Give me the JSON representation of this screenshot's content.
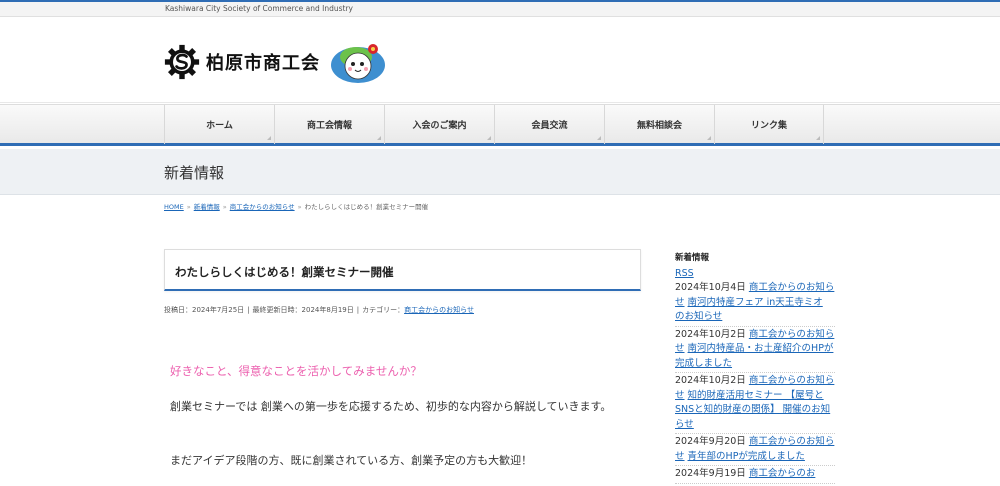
{
  "topbar": {
    "text": "Kashiwara City Society of Commerce and Industry"
  },
  "header": {
    "logo_text": "柏原市商工会"
  },
  "nav": {
    "items": [
      "ホーム",
      "商工会情報",
      "入会のご案内",
      "会員交流",
      "無料相談会",
      "リンク集"
    ]
  },
  "page_title": "新着情報",
  "breadcrumb": {
    "home": "HOME",
    "news": "新着情報",
    "category": "商工会からのお知らせ",
    "current": "わたしらしくはじめる！創業セミナー開催",
    "separator": "»"
  },
  "article": {
    "title": "わたしらしくはじめる！創業セミナー開催",
    "meta": {
      "posted": "投稿日：2024年7月25日",
      "updated": "最終更新日時：2024年8月19日",
      "category_label": "カテゴリー：",
      "category": "商工会からのお知らせ",
      "divider": "|"
    },
    "lead": "好きなこと、得意なことを活かしてみませんか？",
    "paragraph1": "創業セミナーでは 創業への第一歩を応援するため、初歩的な内容から解説していきます。",
    "paragraph2": "まだアイデア段階の方、既に創業されている方、創業予定の方も大歓迎！"
  },
  "sidebar": {
    "heading": "新着情報",
    "rss": "RSS",
    "items": [
      {
        "date": "2024年10月4日",
        "category": "商工会からのお知らせ",
        "title": "南河内特産フェア in天王寺ミオ のお知らせ"
      },
      {
        "date": "2024年10月2日",
        "category": "商工会からのお知らせ",
        "title": "南河内特産品・お土産紹介のHPが完成しました"
      },
      {
        "date": "2024年10月2日",
        "category": "商工会からのお知らせ",
        "title": "知的財産活用セミナー 【屋号とSNSと知的財産の関係】 開催のお知らせ"
      },
      {
        "date": "2024年9月20日",
        "category": "商工会からのお知らせ",
        "title": "青年部のHPが完成しました"
      },
      {
        "date": "2024年9月19日",
        "category": "商工会からのお",
        "title": ""
      }
    ]
  },
  "colors": {
    "accent": "#2f6db5",
    "link": "#1a66b8",
    "lead": "#ec5fae"
  },
  "icons": {
    "logo": "gear-s-logo-icon",
    "mascot": "mascot-character-icon"
  }
}
